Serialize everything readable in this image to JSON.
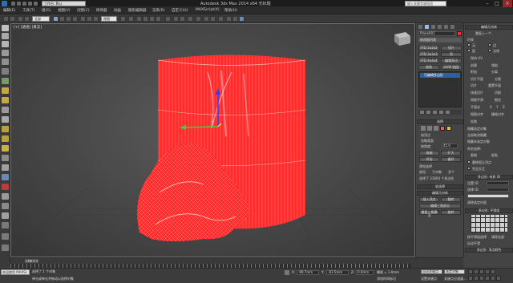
{
  "titlebar": {
    "title": "Autodesk 3ds Max  2014 x64    无标题",
    "search_placeholder": "键入关键字或短语",
    "workspace": "工作台: 默认"
  },
  "menubar": {
    "items": [
      "编辑(E)",
      "工具(T)",
      "组(G)",
      "视图(V)",
      "创建(C)",
      "修改器",
      "动画",
      "图形编辑器",
      "渲染(R)",
      "自定义(U)",
      "MAXScript(X)",
      "帮助(H)"
    ]
  },
  "toolbar": {
    "selection_filter": "全部",
    "view_dropdown": "视图"
  },
  "viewport": {
    "label": "[+] [透视] [真实]"
  },
  "cmdpanel": {
    "object_name": "Plane001",
    "modifier_list": "修改器列表",
    "buttons": [
      "FFD 2x2x2",
      "切片",
      "FFD 3x3x3",
      "壳",
      "FFD 4x4x4",
      "编辑多边",
      "倾角",
      "UVW 贴图"
    ],
    "stack_item": "可编辑多边形",
    "selection_header": "选择",
    "sel_labels": [
      "按顶点",
      "忽略背面",
      "按角度:",
      "收缩",
      "扩大",
      "环形",
      "循环"
    ],
    "angle_value": "45.0",
    "preview_label": "预览选择",
    "preview_options": [
      "禁用",
      "子对象",
      "多个"
    ],
    "selected_info": "选择了 31604 个多边形",
    "soft_header": "软选择",
    "edit_geom_header": "编辑几何体",
    "edit_buttons": [
      "插入顶点",
      "翻转",
      "编辑三角剖分",
      "重复三角算法",
      "旋转"
    ]
  },
  "rollout": {
    "top_label": "编辑几何体",
    "repeat_label": "重复上一个",
    "constraint_label": "约束",
    "options": [
      "无",
      "边",
      "面",
      "法线"
    ],
    "preserve_uv": "保持 UV",
    "create": "创建",
    "collapse": "塌陷",
    "attach": "附加",
    "detach": "分离",
    "slice_plane": "切片平面",
    "split": "分割",
    "slice": "切片",
    "reset_plane": "重置平面",
    "quickslice": "快速切片",
    "cut": "切割",
    "meshsmooth": "网格平滑",
    "tessellate": "细化",
    "make_planar": "平面化",
    "x": "X",
    "y": "Y",
    "z": "Z",
    "view_align": "视图对齐",
    "grid_align": "栅格对齐",
    "relax": "松弛",
    "hide_sel": "隐藏选定对象",
    "unhide_all": "全部取消隐藏",
    "hide_unsel": "隐藏未选定对象",
    "named_sel": "命名选择:",
    "copy": "复制",
    "paste": "粘贴",
    "delete_iso": "删除孤立顶点",
    "full_interact": "完全交互",
    "multi_header": "多边形: 材质 ID",
    "set_id": "设置 ID",
    "select_id": "选择 ID",
    "clear_sel": "清除选定内容",
    "smooth_header": "多边形: 平滑组",
    "select_by_sg": "按平滑组选择",
    "clear_all": "清除全部",
    "auto_smooth": "自动平滑",
    "vertex_colors": "多边形: 顶点颜色",
    "color": "颜色",
    "illum": "照明",
    "alpha": "Alpha",
    "subdiv": "细分曲面",
    "smooth_result": "平滑结果"
  },
  "timeline": {
    "frame": "0 / 100",
    "ticks": [
      "0",
      "5",
      "10",
      "15",
      "20",
      "25",
      "30",
      "35",
      "40",
      "45",
      "50",
      "55",
      "60",
      "65",
      "70",
      "75",
      "80",
      "85",
      "90",
      "95",
      "100"
    ]
  },
  "statusbar": {
    "script_mini": "欢迎使用 MAXSc",
    "status1": "选择了 1 个对象",
    "status2": "单击或单击并拖动以选择对象",
    "x_label": "X:",
    "x_val": "-99.7mm",
    "y_label": "Y:",
    "y_val": "-93.5mm",
    "z_label": "Z:",
    "z_val": "0.0mm",
    "grid": "栅格 = 1.0mm",
    "add_time": "添加时间标记",
    "autokey": "自动关键点",
    "selected": "选定对象",
    "setkey": "设置关键点",
    "keyfilter": "关键点过滤器..."
  },
  "colors": {
    "mesh": "#ff2a2a",
    "selection_blue": "#2f5f9e",
    "viewport_border": "#707070"
  }
}
